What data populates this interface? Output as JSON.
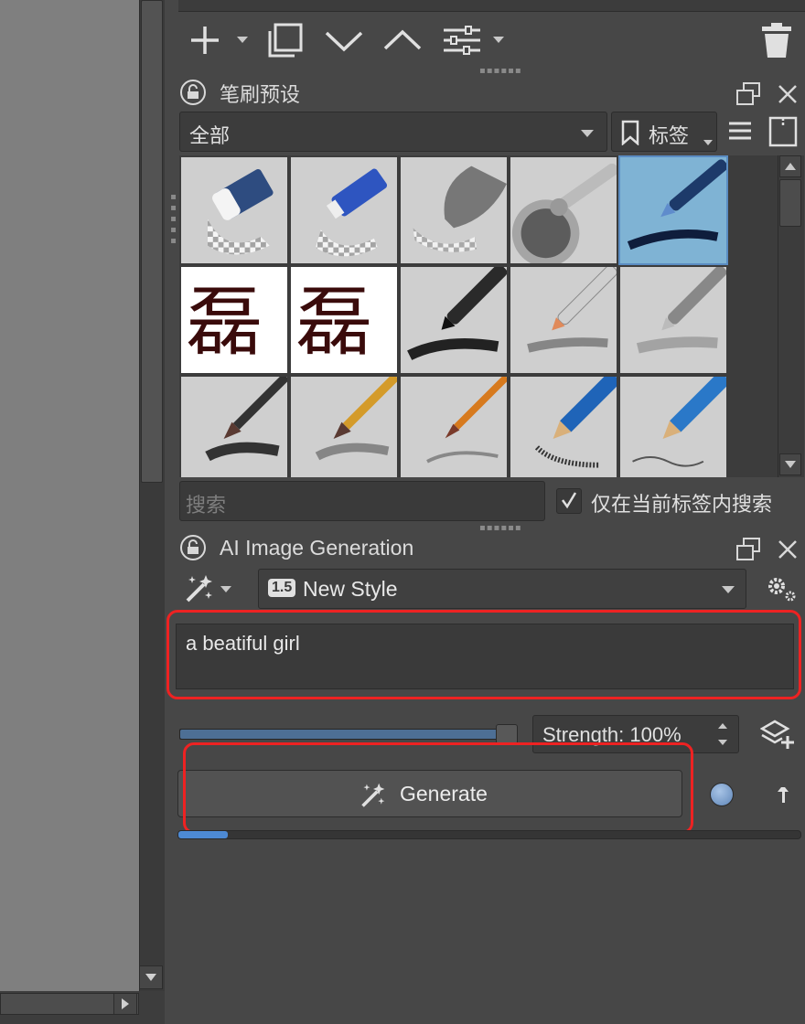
{
  "brush_presets": {
    "title": "笔刷预设",
    "filter_value": "全部",
    "tag_label": "标签",
    "search_placeholder": "搜索",
    "search_current_tag_label": "仅在当前标签内搜索",
    "search_current_tag_checked": true,
    "selected_index": 4,
    "presets": [
      {
        "name": "eraser",
        "bg": "#cfcfcf",
        "kind": "eraser"
      },
      {
        "name": "blue-eraser",
        "bg": "#cfcfcf",
        "kind": "eraser-blue"
      },
      {
        "name": "soft-blend",
        "bg": "#cfcfcf",
        "kind": "blend"
      },
      {
        "name": "airbrush",
        "bg": "#cfcfcf",
        "kind": "airbrush"
      },
      {
        "name": "ink-pen",
        "bg": "#7fb3d4",
        "kind": "ink-pen"
      },
      {
        "name": "texture-ink-1",
        "bg": "#ffffff",
        "kind": "glyph"
      },
      {
        "name": "texture-ink-2",
        "bg": "#ffffff",
        "kind": "glyph"
      },
      {
        "name": "black-marker",
        "bg": "#cfcfcf",
        "kind": "marker"
      },
      {
        "name": "silver-pen",
        "bg": "#cfcfcf",
        "kind": "silver-pen"
      },
      {
        "name": "grey-pen",
        "bg": "#cfcfcf",
        "kind": "grey-pen"
      },
      {
        "name": "brush-dark",
        "bg": "#cfcfcf",
        "kind": "paint-brush"
      },
      {
        "name": "brush-soft",
        "bg": "#cfcfcf",
        "kind": "paint-brush2"
      },
      {
        "name": "brush-thin",
        "bg": "#cfcfcf",
        "kind": "paint-brush3"
      },
      {
        "name": "pencil-blue",
        "bg": "#cfcfcf",
        "kind": "pencil"
      },
      {
        "name": "pencil-sketch",
        "bg": "#cfcfcf",
        "kind": "pencil2"
      }
    ]
  },
  "ai_generation": {
    "title": "AI Image Generation",
    "style_badge": "1.5",
    "style_name": "New Style",
    "prompt_text": "a beatiful girl",
    "strength_label": "Strength: 100%",
    "strength_value": 1.0,
    "generate_label": "Generate",
    "progress": 0.08
  },
  "colors": {
    "accent": "#4d8ad4",
    "highlight_red": "#ee2222",
    "panel_bg": "#474747",
    "selected_preset_bg": "#7fb3d4"
  }
}
